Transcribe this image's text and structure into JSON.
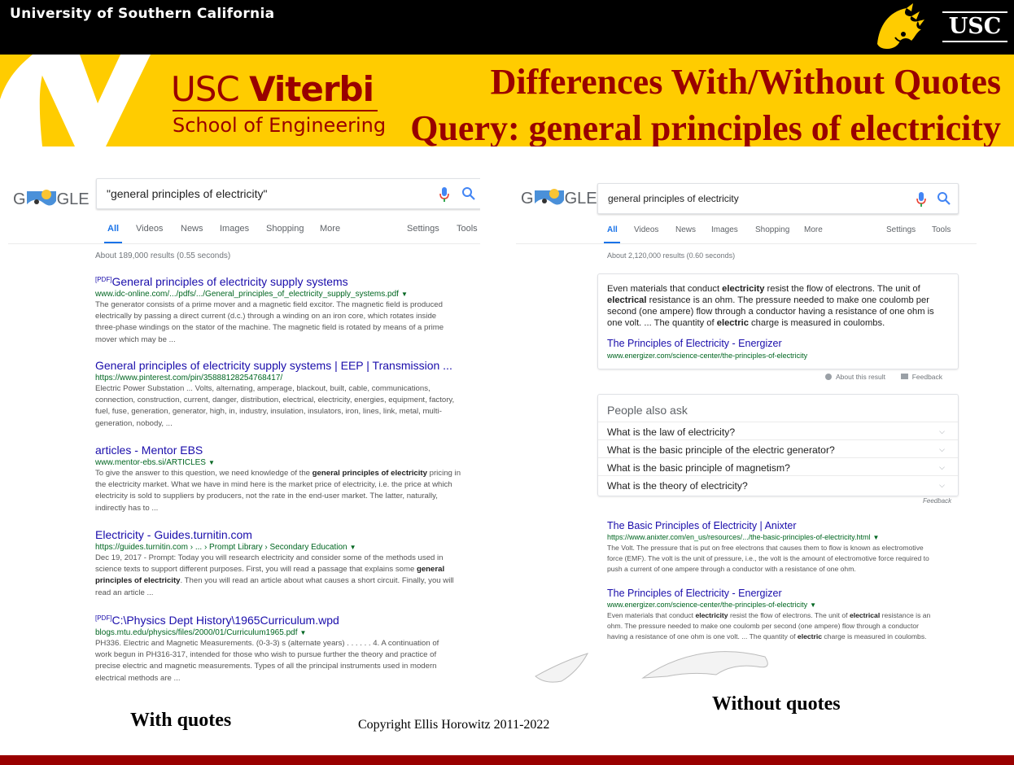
{
  "header": {
    "university": "University of Southern California",
    "usc_logo": "USC",
    "viterbi_prefix": "USC",
    "viterbi_name": "Viterbi",
    "school": "School of Engineering",
    "title_line1": "Differences With/Without Quotes",
    "title_line2": "Query: general principles of electricity"
  },
  "colors": {
    "cardinal": "#990000",
    "gold": "#FFCC00",
    "link": "#1a0dab",
    "url": "#006621"
  },
  "left": {
    "logo": "GLE",
    "query": "\"general principles of electricity\"",
    "tabs": [
      "All",
      "Videos",
      "News",
      "Images",
      "Shopping",
      "More"
    ],
    "settings": "Settings",
    "tools": "Tools",
    "stats": "About 189,000 results (0.55 seconds)",
    "results": [
      {
        "badge": "[PDF]",
        "title": "General principles of electricity supply systems",
        "url": "www.idc-online.com/.../pdfs/.../General_principles_of_electricity_supply_systems.pdf",
        "lines": [
          "The generator consists of a prime mover and a magnetic field excitor. The magnetic field is produced",
          "electrically by passing a direct current (d.c.) through a winding on an iron core, which rotates inside",
          "three-phase windings on the stator of the machine. The magnetic field is rotated by means of a prime",
          "mover which may be ..."
        ]
      },
      {
        "title": "General principles of electricity supply systems | EEP | Transmission ...",
        "url": "https://www.pinterest.com/pin/358881282547684​17/",
        "lines": [
          "Electric Power Substation ... Volts, alternating, amperage, blackout, built, cable, communications,",
          "connection, construction, current, danger, distribution, electrical, electricity, energies, equipment, factory,",
          "fuel, fuse, generation, generator, high, in, industry, insulation, insulators, iron, lines, link, metal, multi-",
          "generation, nobody, ..."
        ]
      },
      {
        "title": "articles - Mentor EBS",
        "url": "www.mentor-ebs.si/ARTICLES",
        "line1_pre": "To give the answer to this question, we need knowledge of the ",
        "line1_bold": "general principles of electricity",
        "line1_post": " pricing in",
        "lines": [
          "the electricity market. What we have in mind here is the market price of electricity, i.e. the price at which",
          "electricity is sold to suppliers by producers, not the rate in the end-user market. The latter, naturally,",
          "indirectly has to ..."
        ]
      },
      {
        "title": "Electricity - Guides.turnitin.com",
        "url": "https://guides.turnitin.com › ... › Prompt Library › Secondary Education",
        "line1": "Dec 19, 2017 - Prompt: Today you will research electricity and consider some of the methods used in",
        "line2_pre": "science texts to support different purposes. First, you will read a passage that explains some ",
        "line2_bold": "general",
        "line3_bold": "principles of electricity",
        "line3_post": ". Then you will read an article about what causes a short circuit. Finally, you will",
        "line4": "read an article ..."
      },
      {
        "badge": "[PDF]",
        "title": "C:\\Physics Dept History\\1965Curriculum.wpd",
        "url": "blogs.mtu.edu/physics/files/2000/01/Curriculum1965.pdf",
        "lines": [
          "PH336. Electric and Magnetic Measurements. (0-3-3) s (alternate years) . . . . . . 4. A continuation of",
          "work begun in PH316-317, intended for those who wish to pursue further the theory and practice of",
          "precise electric and magnetic measurements. Types of all the principal instruments used in modern",
          "electrical methods are ..."
        ]
      }
    ]
  },
  "right": {
    "logo": "GLE",
    "query": "general principles of electricity",
    "tabs": [
      "All",
      "Videos",
      "News",
      "Images",
      "Shopping",
      "More"
    ],
    "settings": "Settings",
    "tools": "Tools",
    "stats": "About 2,120,000 results (0.60 seconds)",
    "snippet": {
      "t1": "Even materials that conduct ",
      "b1": "electricity",
      "t2": " resist the flow of electrons. The unit of ",
      "b2": "electrical",
      "t3": " resistance is an ohm. The pressure needed to make one coulomb per second (one ampere) flow through a conductor having a resistance of one ohm is one volt. ... The quantity of ",
      "b3": "electric",
      "t4": " charge is measured in coulombs.",
      "link": "The Principles of Electricity - Energizer",
      "url": "www.energizer.com/science-center/the-principles-of-electricity"
    },
    "about_result": "About this result",
    "feedback": "Feedback",
    "paa_heading": "People also ask",
    "paa": [
      "What is the law of electricity?",
      "What is the basic principle of the electric generator?",
      "What is the basic principle of magnetism?",
      "What is the theory of electricity?"
    ],
    "paa_feedback": "Feedback",
    "results": [
      {
        "title": "The Basic Principles of Electricity | Anixter",
        "url": "https://www.anixter.com/en_us/resources/.../the-basic-principles-of-electricity.html",
        "lines": [
          "The Volt. The pressure that is put on free electrons that causes them to flow is known as electromotive",
          "force (EMF). The volt is the unit of pressure, i.e., the volt is the amount of electromotive force required to",
          "push a current of one ampere through a conductor with a resistance of one ohm."
        ]
      },
      {
        "title": "The Principles of Electricity - Energizer",
        "url": "www.energizer.com/science-center/the-principles-of-electricity",
        "l1_pre": "Even materials that conduct ",
        "l1_b": "electricity",
        "l1_mid": " resist the flow of electrons. The unit of ",
        "l1_b2": "electrical",
        "l1_post": " resistance is an",
        "l2": "ohm. The pressure needed to make one coulomb per second (one ampere) flow through a conductor",
        "l3_pre": "having a resistance of one ohm is one volt. ... The quantity of ",
        "l3_b": "electric",
        "l3_post": " charge is measured in coulombs."
      }
    ]
  },
  "captions": {
    "left": "With quotes",
    "right": "Without quotes",
    "copyright": "Copyright Ellis Horowitz 2011-2022"
  },
  "icons": {
    "mic": "microphone-icon",
    "search": "search-icon",
    "dropdown": "dropdown-arrow-icon",
    "chevron": "chevron-down-icon",
    "trojan": "trojan-head-icon"
  }
}
